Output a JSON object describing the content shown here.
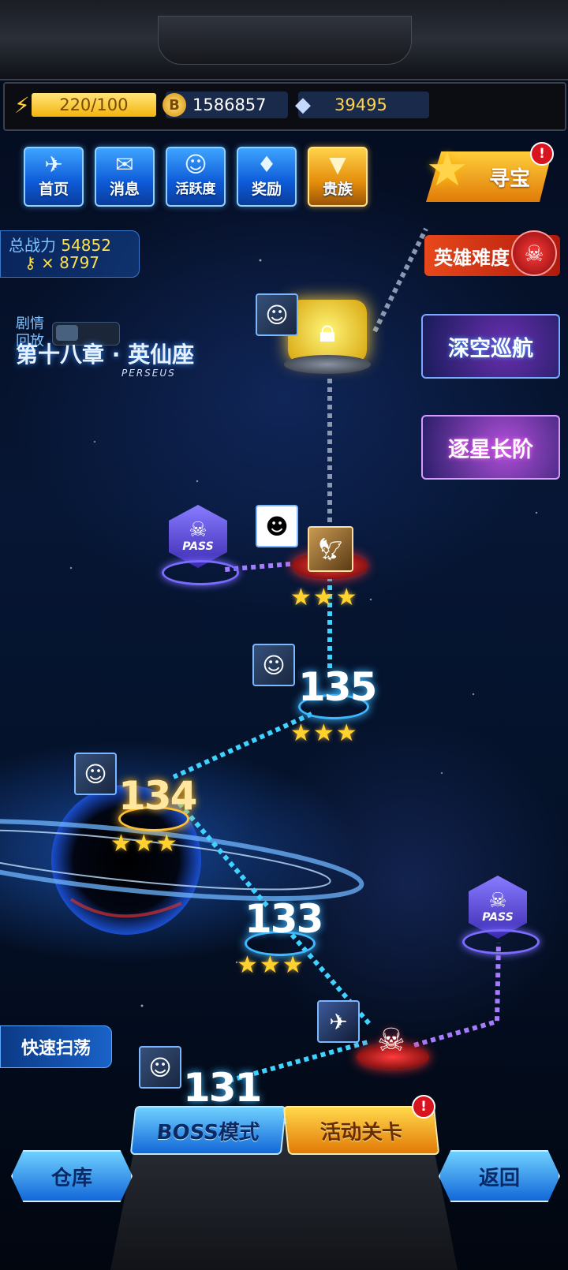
{
  "resources": {
    "energy": "220/100",
    "gold": "1586857",
    "diamond": "39495"
  },
  "nav": {
    "home": "首页",
    "messages": "消息",
    "activity": "活跃度",
    "rewards": "奖励",
    "noble": "贵族"
  },
  "treasure": {
    "label": "寻宝",
    "badge": "!"
  },
  "power": {
    "label": "总战力",
    "value": "54852",
    "keys": "× 8797"
  },
  "story": {
    "label": "剧情回放"
  },
  "chapter": {
    "title": "第十八章 · 英仙座",
    "subtitle": "PERSEUS"
  },
  "right_menu": {
    "hero": "英雄难度",
    "deep_space": "深空巡航",
    "ladder": "逐星长阶"
  },
  "levels": [
    {
      "number": "135",
      "stars": 3
    },
    {
      "number": "134",
      "stars": 3
    },
    {
      "number": "133",
      "stars": 3
    },
    {
      "number": "131"
    }
  ],
  "pass_label": "PASS",
  "quick_sweep": "快速扫荡",
  "boss_mode": "BOSS模式",
  "event_stage": {
    "label": "活动关卡",
    "badge": "!"
  },
  "warehouse": "仓库",
  "back": "返回",
  "icons": [
    "lightning-icon",
    "coin-icon",
    "diamond-icon",
    "lock-icon",
    "skull-icon",
    "key-icon",
    "star-icon"
  ]
}
